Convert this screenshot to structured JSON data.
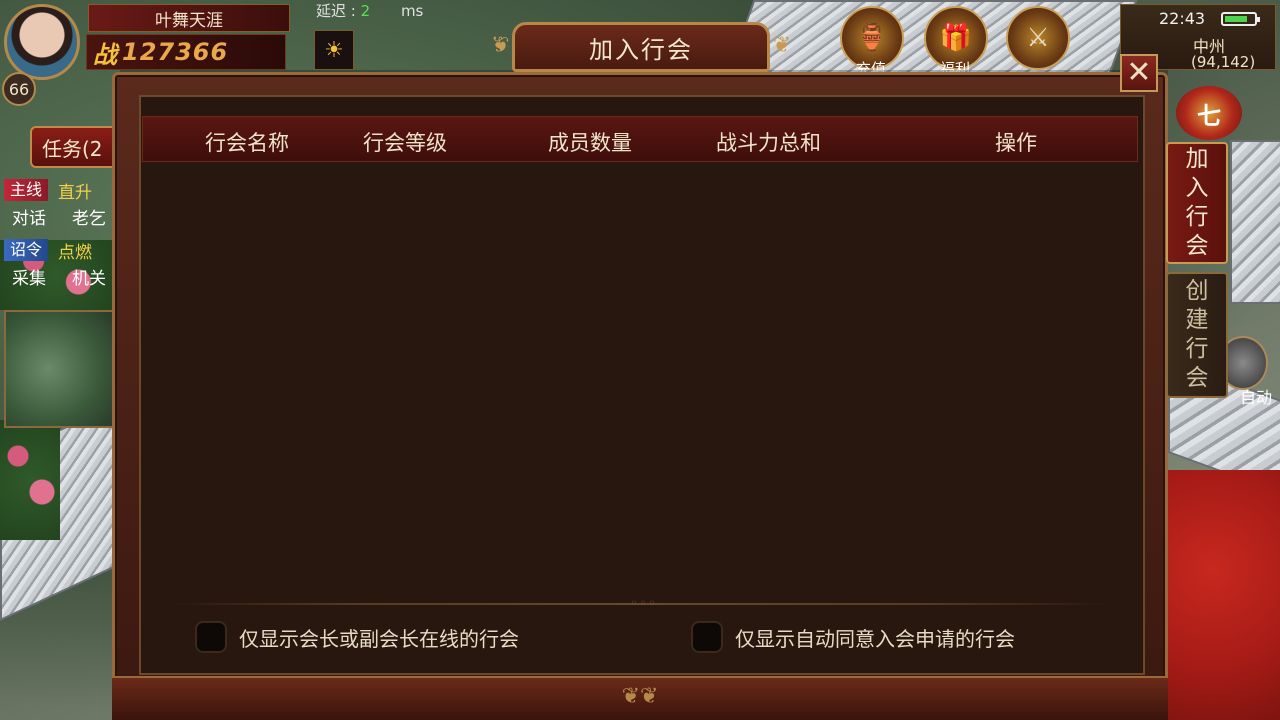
{
  "player": {
    "name": "叶舞天涯",
    "level": "66",
    "power": "127366",
    "power_prefix": "战"
  },
  "network": {
    "latency_label": "延迟 :",
    "latency_value": "2",
    "latency_unit": "ms"
  },
  "status": {
    "time": "22:43",
    "map_name": "中州",
    "coords": "(94,142)"
  },
  "hud": {
    "task_button": "任务(2",
    "quests": [
      {
        "tag": "主线",
        "text": "直升"
      },
      {
        "tag": "对话",
        "text": "老乞"
      },
      {
        "tag": "诏令",
        "text": "点燃"
      },
      {
        "tag": "采集",
        "text": "机关"
      }
    ],
    "top_icons": [
      {
        "icon": "gold-ingot-icon",
        "glyph": "🏺",
        "label": "充值"
      },
      {
        "icon": "gift-box-icon",
        "glyph": "🎁",
        "label": "福利"
      }
    ],
    "event_glyph": "七",
    "auto_label": "自动"
  },
  "dialog": {
    "title": "加入行会",
    "close_glyph": "✕",
    "columns": [
      "行会名称",
      "行会等级",
      "成员数量",
      "战斗力总和",
      "操作"
    ],
    "rows": [],
    "filters": [
      {
        "label": "仅显示会长或副会长在线的行会",
        "checked": false
      },
      {
        "label": "仅显示自动同意入会申请的行会",
        "checked": false
      }
    ]
  },
  "side_tabs": [
    {
      "chars": [
        "加",
        "入",
        "行",
        "会"
      ],
      "active": true
    },
    {
      "chars": [
        "创",
        "建",
        "行",
        "会"
      ],
      "active": false
    }
  ],
  "colors": {
    "accent_gold": "#b8874a",
    "header_red": "#5a1612",
    "panel_dark": "#27170f",
    "latency_green": "#55e055"
  }
}
